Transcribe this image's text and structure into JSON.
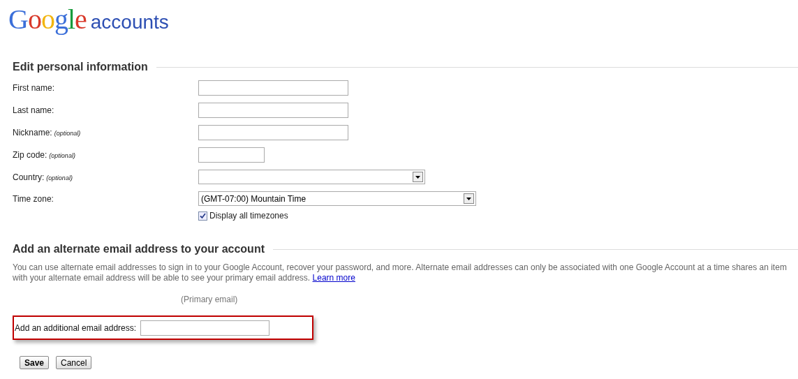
{
  "logo": {
    "brand": "Google",
    "product": "accounts"
  },
  "personal": {
    "title": "Edit personal information",
    "fields": [
      {
        "label": "First name:",
        "kind": "text"
      },
      {
        "label": "Last name:",
        "kind": "text"
      },
      {
        "label": "Nickname:",
        "note": "(optional)",
        "kind": "text"
      },
      {
        "label": "Zip code:",
        "note": "(optional)",
        "kind": "zip"
      },
      {
        "label": "Country:",
        "note": "(optional)",
        "kind": "select"
      },
      {
        "label": "Time zone:",
        "kind": "wide-select",
        "value": "(GMT-07:00) Mountain Time"
      }
    ],
    "checkbox": {
      "label": "Display all timezones",
      "checked": true
    }
  },
  "alternate": {
    "title": "Add an alternate email address to your account",
    "description": "You can use alternate email addresses to sign in to your Google Account, recover your password, and more. Alternate email addresses can only be associated with one Google Account at a time",
    "description_2": "shares an item with your alternate email address will be able to see your primary email address.",
    "link": "Learn more",
    "primary": "(Primary email)",
    "add_label": "Add an additional email address:"
  },
  "buttons": [
    {
      "label": "Save",
      "primary": true
    },
    {
      "label": "Cancel",
      "primary": false
    }
  ]
}
